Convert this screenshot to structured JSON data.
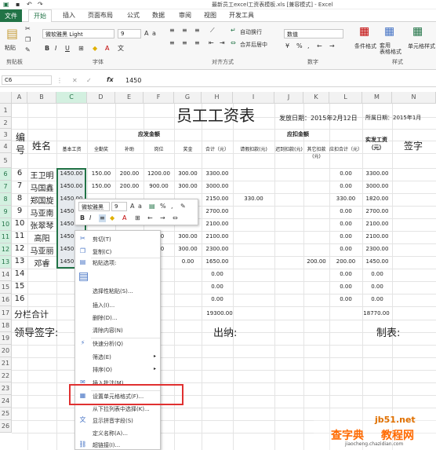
{
  "window": {
    "title": "最新员工excel工资表模板.xls [兼容模式] - Excel"
  },
  "tabs": [
    "文件",
    "开始",
    "插入",
    "页面布局",
    "公式",
    "数据",
    "审阅",
    "视图",
    "开发工具"
  ],
  "ribbon": {
    "paste": "粘贴",
    "clipboard": "剪贴板",
    "font_name": "微软雅黑 Light",
    "font_size": "9",
    "font_group": "字体",
    "wrap": "自动换行",
    "merge": "合并后居中",
    "align_group": "对齐方式",
    "number_format": "数值",
    "number_group": "数字",
    "cond_format": "条件格式",
    "table_format": "套用\n表格格式",
    "cell_style": "单元格样式",
    "style_group": "样式"
  },
  "formula_bar": {
    "name_box": "C6",
    "value": "1450"
  },
  "columns": [
    "A",
    "B",
    "C",
    "D",
    "E",
    "F",
    "G",
    "H",
    "I",
    "J",
    "K",
    "L",
    "M",
    "N"
  ],
  "rows": [
    "1",
    "2",
    "3",
    "4",
    "5",
    "6",
    "7",
    "8",
    "9",
    "10",
    "11",
    "12",
    "13",
    "14",
    "15",
    "16",
    "17",
    "18",
    "19",
    "20",
    "21",
    "22",
    "23",
    "24",
    "25",
    "26"
  ],
  "sheet": {
    "title": "员工工资表",
    "issue_date": "发放日期：2015年2月12日",
    "period": "所属日期：2015年1月",
    "h_no": "编号",
    "h_name": "姓名",
    "h_pay": "应发金额",
    "h_ded": "应扣金额",
    "h_net": "实发工资（元）",
    "h_sign": "签字",
    "sub": [
      "基本工资",
      "全勤奖",
      "补助",
      "岗位",
      "奖金",
      "合计（元）",
      "请假扣款(元)",
      "迟到扣款(元)",
      "其它扣款(元)",
      "应扣合计（元）"
    ],
    "data": [
      {
        "no": "6",
        "name": "王卫明",
        "base": "1450.00",
        "att": "150.00",
        "sub": "200.00",
        "post": "1200.00",
        "bonus": "300.00",
        "total": "3300.00",
        "leave": "",
        "late": "",
        "other": "",
        "dedtotal": "0.00",
        "net": "3300.00"
      },
      {
        "no": "7",
        "name": "马国鑫",
        "base": "1450.00",
        "att": "150.00",
        "sub": "200.00",
        "post": "900.00",
        "bonus": "300.00",
        "total": "3000.00",
        "leave": "",
        "late": "",
        "other": "",
        "dedtotal": "0.00",
        "net": "3000.00"
      },
      {
        "no": "8",
        "name": "郑国旋",
        "base": "1450.00",
        "att": "",
        "sub": "",
        "post": "",
        "bonus": "",
        "total": "2150.00",
        "leave": "330.00",
        "late": "",
        "other": "",
        "dedtotal": "330.00",
        "net": "1820.00"
      },
      {
        "no": "9",
        "name": "马亚南",
        "base": "1450.00",
        "att": "",
        "sub": "",
        "post": "",
        "bonus": "",
        "total": "2700.00",
        "leave": "",
        "late": "",
        "other": "",
        "dedtotal": "0.00",
        "net": "2700.00"
      },
      {
        "no": "10",
        "name": "张翠琴",
        "base": "1450.00",
        "att": "",
        "sub": "",
        "post": "",
        "bonus": "",
        "total": "2100.00",
        "leave": "",
        "late": "",
        "other": "",
        "dedtotal": "0.00",
        "net": "2100.00"
      },
      {
        "no": "11",
        "name": "高阳",
        "base": "1450.00",
        "att": "",
        "sub": "",
        "post": "200",
        "bonus": "300.00",
        "total": "2100.00",
        "leave": "",
        "late": "",
        "other": "",
        "dedtotal": "0.00",
        "net": "2100.00"
      },
      {
        "no": "12",
        "name": "马亚丽",
        "base": "1450.00",
        "att": "",
        "sub": "",
        "post": "200",
        "bonus": "300.00",
        "total": "2300.00",
        "leave": "",
        "late": "",
        "other": "",
        "dedtotal": "0.00",
        "net": "2300.00"
      },
      {
        "no": "13",
        "name": "邓睿",
        "base": "1450.00",
        "att": "",
        "sub": "",
        "post": "",
        "bonus": "0.00",
        "total": "1650.00",
        "leave": "",
        "late": "",
        "other": "200.00",
        "dedtotal": "200.00",
        "net": "1450.00"
      }
    ],
    "empty_rows": [
      "14",
      "15",
      "16"
    ],
    "empty_total": "0.00",
    "sum_label": "分栏合计",
    "sum_total": "19300.00",
    "sum_net": "18770.00",
    "leader": "领导签字:",
    "cashier": "出纳:",
    "maker": "制表:"
  },
  "mini_toolbar": {
    "font": "微软雅黑",
    "size": "9"
  },
  "context_menu": [
    {
      "label": "剪切(T)",
      "icon": "scissors-icon"
    },
    {
      "label": "复制(C)",
      "icon": "copy-icon"
    },
    {
      "label": "粘贴选项:",
      "icon": "paste-options-icon"
    },
    {
      "label": "",
      "icon": "paste-icon"
    },
    {
      "label": "选择性粘贴(S)...",
      "icon": ""
    },
    {
      "label": "插入(I)...",
      "icon": ""
    },
    {
      "label": "删除(D)...",
      "icon": ""
    },
    {
      "label": "清除内容(N)",
      "icon": ""
    },
    {
      "label": "快速分析(Q)",
      "icon": "quick-analysis-icon"
    },
    {
      "label": "筛选(E)",
      "icon": ""
    },
    {
      "label": "排序(O)",
      "icon": ""
    },
    {
      "label": "插入批注(M)",
      "icon": "comment-icon"
    },
    {
      "label": "设置单元格格式(F)...",
      "icon": "format-cells-icon"
    },
    {
      "label": "从下拉列表中选择(K)...",
      "icon": ""
    },
    {
      "label": "显示拼音字段(S)",
      "icon": "phonetic-icon"
    },
    {
      "label": "定义名称(A)...",
      "icon": ""
    },
    {
      "label": "超链接(I)...",
      "icon": "hyperlink-icon"
    }
  ],
  "watermark": {
    "site": "jb51.net",
    "brand": "查字典",
    "brand2": "教程网",
    "url": "jiaocheng.chazidian.com"
  },
  "colors": {
    "excel_green": "#217346",
    "highlight_red": "#e03030",
    "title_red": "#c00000"
  }
}
